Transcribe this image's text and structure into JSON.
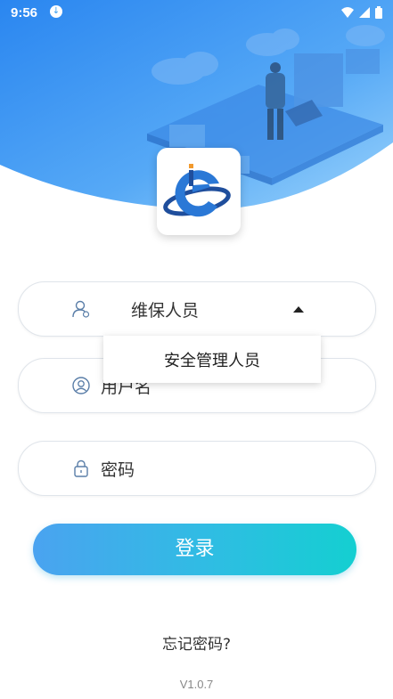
{
  "status_bar": {
    "time": "9:56"
  },
  "form": {
    "role_value": "维保人员",
    "role_options": [
      "安全管理人员"
    ],
    "username_placeholder": "用户名",
    "password_placeholder": "密码",
    "login_label": "登录"
  },
  "forgot_password": "忘记密码?",
  "version": "V1.0.7",
  "colors": {
    "header_gradient_start": "#2c8ef2",
    "header_gradient_end": "#7cc8fb",
    "button_start": "#4aa3f0",
    "button_end": "#14cfd1"
  }
}
